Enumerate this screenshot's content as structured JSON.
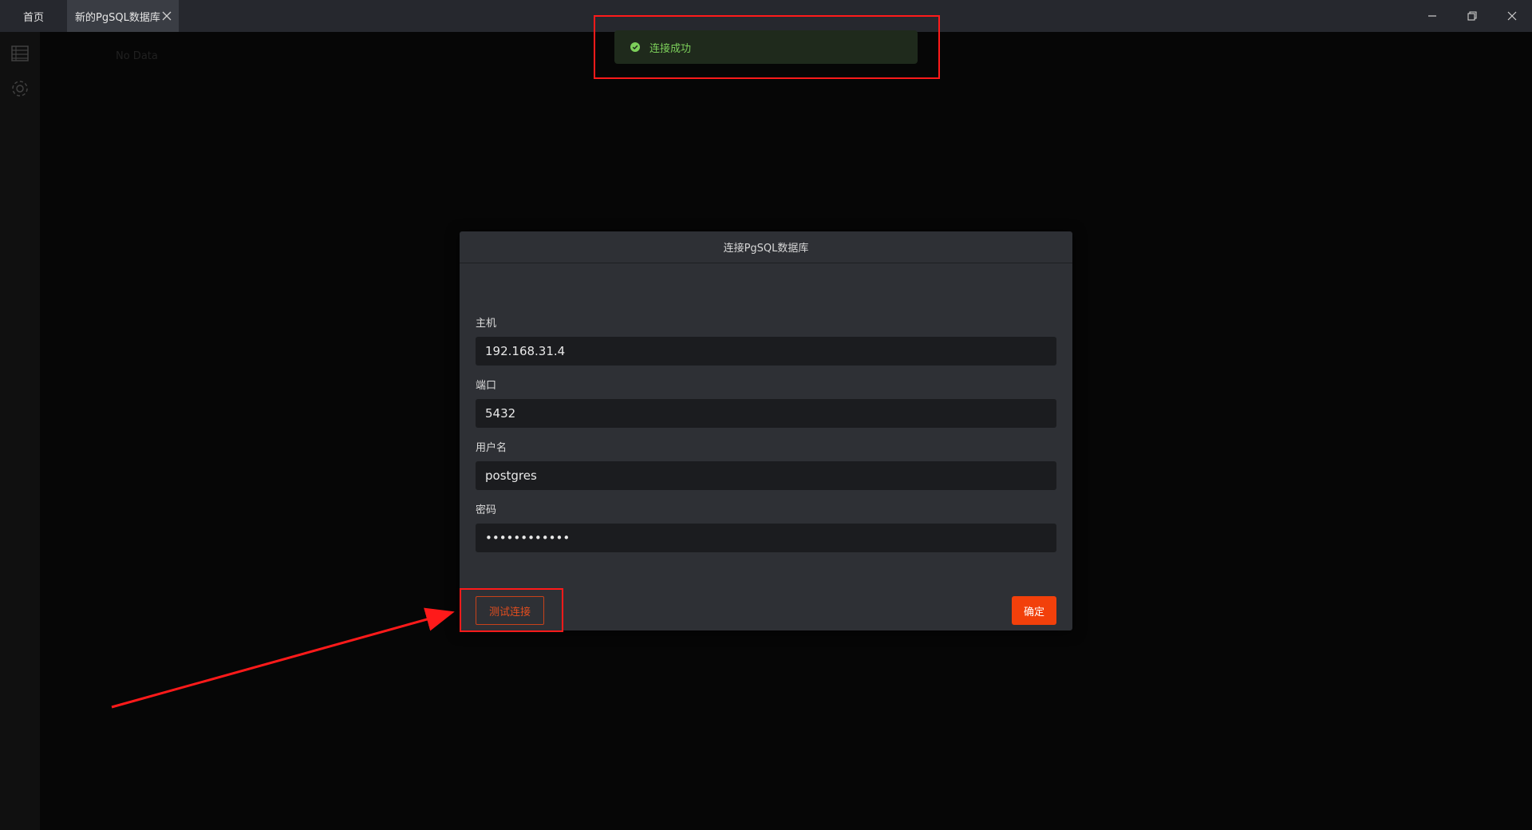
{
  "tabs": [
    {
      "label": "首页"
    },
    {
      "label": "新的PgSQL数据库"
    }
  ],
  "main": {
    "empty_text": "No Data"
  },
  "toast": {
    "message": "连接成功",
    "status_color": "#7ccf5a"
  },
  "dialog": {
    "title": "连接PgSQL数据库",
    "fields": [
      {
        "label": "主机",
        "value": "192.168.31.4"
      },
      {
        "label": "端口",
        "value": "5432"
      },
      {
        "label": "用户名",
        "value": "postgres"
      },
      {
        "label": "密码",
        "value": "••••••••••••"
      }
    ],
    "test_button": "测试连接",
    "confirm_button": "确定"
  },
  "colors": {
    "accent": "#f2400b",
    "highlight": "#ff1a1a"
  },
  "icons": [
    "close-icon",
    "minimize-icon",
    "restore-icon",
    "window-close-icon",
    "database-icon",
    "settings-gear-icon",
    "check-circle-icon"
  ]
}
